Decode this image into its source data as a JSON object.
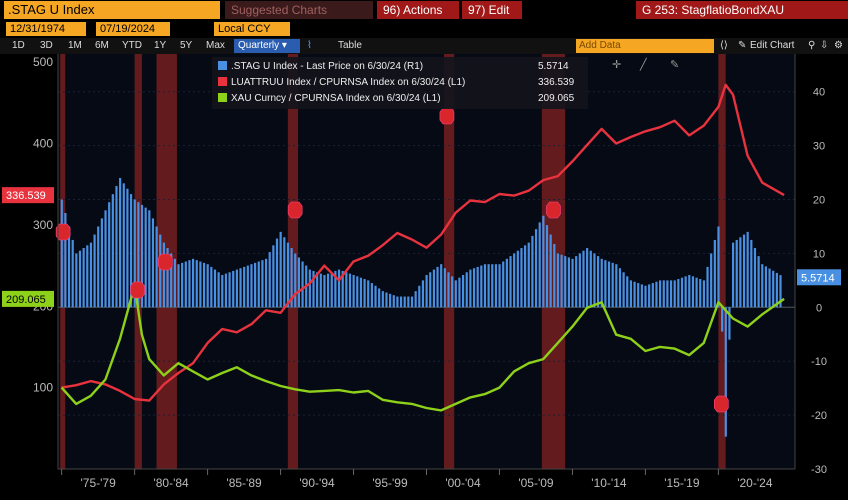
{
  "topbar": {
    "ticker": ".STAG U Index",
    "suggested": "Suggested Charts",
    "actions": "96) Actions",
    "edit": "97) Edit",
    "chart_title": "G 253: StagflatioBondXAU"
  },
  "datebar": {
    "start": "12/31/1974",
    "end": "07/19/2024",
    "currency": "Local CCY"
  },
  "periodbar": {
    "periods": [
      "1D",
      "3D",
      "1M",
      "6M",
      "YTD",
      "1Y",
      "5Y",
      "Max"
    ],
    "frequency": "Quarterly",
    "table": "Table",
    "add_data": "Add Data",
    "edit_chart": "Edit Chart"
  },
  "legend": [
    {
      "label": ".STAG U Index - Last Price on 6/30/24 (R1)",
      "value": "5.5714",
      "color": "#4a90e2"
    },
    {
      "label": "LUATTRUU Index / CPURNSA Index on 6/30/24 (L1)",
      "value": "336.539",
      "color": "#e8333f"
    },
    {
      "label": "XAU Curncy / CPURNSA Index on 6/30/24 (L1)",
      "value": "209.065",
      "color": "#8ed11a"
    }
  ],
  "colors": {
    "bars": "#4a90e2",
    "bond": "#e8333f",
    "gold": "#8ed11a",
    "recession": "#7a1f1f",
    "orange": "#f5a623"
  },
  "chart_data": {
    "type": "line",
    "x_ticks": [
      "'75-'79",
      "'80-'84",
      "'85-'89",
      "'90-'94",
      "'95-'99",
      "'00-'04",
      "'05-'09",
      "'10-'14",
      "'15-'19",
      "'20-'24"
    ],
    "left_axis": {
      "ticks": [
        100,
        200,
        300,
        400,
        500
      ],
      "range": [
        0,
        510
      ]
    },
    "right_axis": {
      "ticks": [
        -30,
        -20,
        -10,
        0,
        10,
        20,
        30,
        40
      ],
      "range": [
        -30,
        47
      ]
    },
    "last_value_labels": {
      "bond": "336.539",
      "gold": "209.065",
      "stag": "5.5714"
    },
    "recessions": [
      [
        1974.9,
        1975.25
      ],
      [
        1980.0,
        1980.5
      ],
      [
        1981.5,
        1982.9
      ],
      [
        1990.5,
        1991.2
      ],
      [
        2001.2,
        2001.9
      ],
      [
        2007.9,
        2009.5
      ],
      [
        2020.0,
        2020.5
      ]
    ],
    "series": [
      {
        "name": "LUATTRUU Index / CPURNSA Index",
        "axis": "L1",
        "x": [
          1975,
          1976,
          1977,
          1978,
          1979,
          1980,
          1981,
          1982,
          1983,
          1984,
          1985,
          1986,
          1987,
          1988,
          1989,
          1990,
          1991,
          1992,
          1993,
          1994,
          1995,
          1996,
          1997,
          1998,
          1999,
          2000,
          2001,
          2002,
          2003,
          2004,
          2005,
          2006,
          2007,
          2008,
          2009,
          2010,
          2011,
          2012,
          2013,
          2014,
          2015,
          2016,
          2017,
          2018,
          2019,
          2020,
          2020.5,
          2021,
          2022,
          2023,
          2024.5
        ],
        "y": [
          100,
          103,
          108,
          104,
          96,
          86,
          84,
          104,
          118,
          130,
          155,
          172,
          168,
          178,
          195,
          192,
          215,
          228,
          250,
          232,
          255,
          262,
          275,
          290,
          282,
          272,
          288,
          315,
          330,
          328,
          338,
          336,
          342,
          355,
          360,
          378,
          398,
          418,
          400,
          408,
          415,
          420,
          428,
          410,
          422,
          445,
          472,
          460,
          385,
          352,
          336.539
        ]
      },
      {
        "name": "XAU Curncy / CPURNSA Index",
        "axis": "L1",
        "x": [
          1975,
          1976,
          1977,
          1978,
          1979,
          1980,
          1980.5,
          1981,
          1982,
          1983,
          1984,
          1985,
          1986,
          1987,
          1988,
          1989,
          1990,
          1991,
          1992,
          1993,
          1994,
          1995,
          1996,
          1997,
          1998,
          1999,
          2000,
          2001,
          2002,
          2003,
          2004,
          2005,
          2006,
          2007,
          2008,
          2009,
          2010,
          2011,
          2012,
          2013,
          2014,
          2015,
          2016,
          2017,
          2018,
          2019,
          2020,
          2021,
          2022,
          2023,
          2024.5
        ],
        "y": [
          100,
          80,
          90,
          110,
          160,
          225,
          165,
          135,
          115,
          130,
          120,
          110,
          118,
          125,
          115,
          108,
          102,
          98,
          95,
          96,
          97,
          94,
          96,
          85,
          82,
          80,
          75,
          72,
          80,
          88,
          92,
          100,
          120,
          130,
          135,
          155,
          175,
          198,
          205,
          165,
          160,
          145,
          150,
          148,
          140,
          155,
          205,
          185,
          175,
          190,
          209.065
        ]
      },
      {
        "name": ".STAG U Index",
        "axis": "R1",
        "x": [
          1975,
          1976,
          1977,
          1978,
          1979,
          1980,
          1981,
          1982,
          1983,
          1984,
          1985,
          1986,
          1987,
          1988,
          1989,
          1990,
          1991,
          1992,
          1993,
          1994,
          1995,
          1996,
          1997,
          1998,
          1999,
          2000,
          2001,
          2002,
          2003,
          2004,
          2005,
          2006,
          2007,
          2008,
          2009,
          2010,
          2011,
          2012,
          2013,
          2014,
          2015,
          2016,
          2017,
          2018,
          2019,
          2020,
          2020.5,
          2021,
          2022,
          2023,
          2024.5
        ],
        "y": [
          20,
          10,
          12,
          18,
          24,
          20,
          18,
          12,
          8,
          9,
          8,
          6,
          7,
          8,
          9,
          14,
          10,
          7,
          6,
          7,
          6,
          5,
          3,
          2,
          2,
          6,
          8,
          5,
          7,
          8,
          8,
          10,
          12,
          17,
          10,
          9,
          11,
          9,
          8,
          5,
          4,
          5,
          5,
          6,
          5,
          15,
          -24,
          12,
          14,
          8,
          5.5714
        ]
      }
    ]
  }
}
